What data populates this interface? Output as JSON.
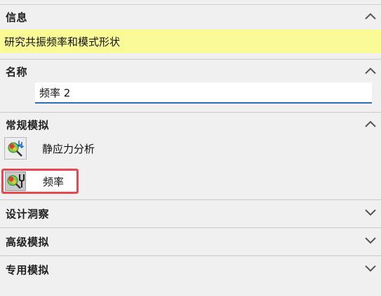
{
  "sections": {
    "info": {
      "title": "信息",
      "text": "研究共振频率和模式形状",
      "expanded": true
    },
    "name": {
      "title": "名称",
      "value": "频率 2",
      "expanded": true
    },
    "general": {
      "title": "常规模拟",
      "expanded": true,
      "items": [
        {
          "label": "静应力分析",
          "icon": "static-stress-icon"
        },
        {
          "label": "频率",
          "icon": "frequency-icon",
          "selected": true
        }
      ]
    },
    "design": {
      "title": "设计洞察",
      "expanded": false
    },
    "advanced": {
      "title": "高级模拟",
      "expanded": false
    },
    "special": {
      "title": "专用模拟",
      "expanded": false
    }
  },
  "colors": {
    "info_highlight": "#fafa96",
    "input_underline": "#2f6eb5",
    "selection_outline": "#e8474f"
  }
}
